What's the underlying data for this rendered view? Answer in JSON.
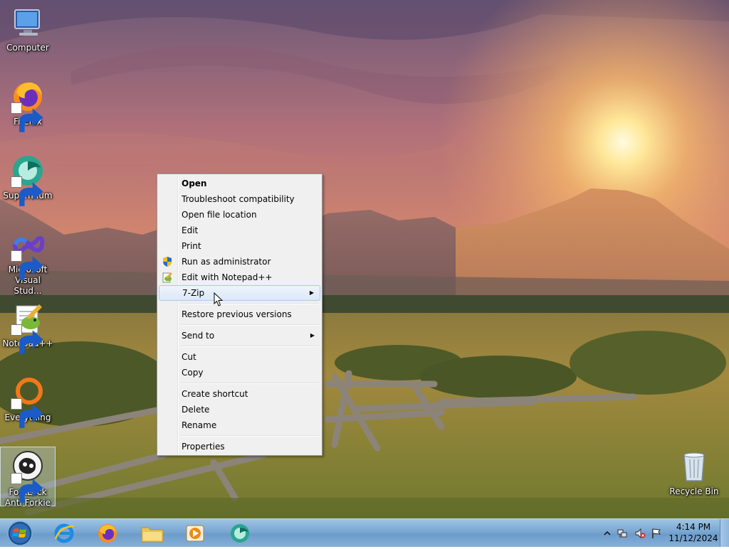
{
  "desktop": {
    "icons": [
      {
        "label": "Computer",
        "icon": "computer-icon"
      },
      {
        "label": "Firefox",
        "icon": "firefox-icon"
      },
      {
        "label": "Supermium",
        "icon": "supermium-icon"
      },
      {
        "label": "Microsoft Visual Stud...",
        "icon": "visual-studio-icon"
      },
      {
        "label": "Notepad++",
        "icon": "notepad-plus-plus-icon"
      },
      {
        "label": "Everything",
        "icon": "everything-icon"
      },
      {
        "label": "ForkLock Anti Forkie",
        "icon": "forklock-icon"
      },
      {
        "label": "Recycle Bin",
        "icon": "recycle-bin-icon"
      }
    ]
  },
  "context_menu": {
    "items": [
      {
        "label": "Open",
        "bold": true
      },
      {
        "label": "Troubleshoot compatibility"
      },
      {
        "label": "Open file location"
      },
      {
        "label": "Edit"
      },
      {
        "label": "Print"
      },
      {
        "label": "Run as administrator",
        "icon": "uac-shield-icon"
      },
      {
        "label": "Edit with Notepad++",
        "icon": "notepad-plus-plus-icon"
      },
      {
        "label": "7-Zip",
        "submenu": true,
        "hover": true
      },
      {
        "label": "Restore previous versions"
      },
      {
        "label": "Send to",
        "submenu": true
      },
      {
        "label": "Cut"
      },
      {
        "label": "Copy"
      },
      {
        "label": "Create shortcut"
      },
      {
        "label": "Delete"
      },
      {
        "label": "Rename"
      },
      {
        "label": "Properties"
      }
    ],
    "submenu_arrow": "▶"
  },
  "taskbar": {
    "pinned": [
      "internet-explorer-icon",
      "firefox-icon",
      "file-explorer-icon",
      "media-player-icon",
      "supermium-icon"
    ],
    "tray_icons": [
      "show-hidden-icons-chevron",
      "network-icon",
      "volume-muted-icon",
      "action-center-flag-icon"
    ],
    "clock": {
      "time": "4:14 PM",
      "date": "11/12/2024"
    }
  },
  "colors": {
    "menu_bg": "#f0f0f0",
    "menu_hover": "#dce9f7",
    "taskbar": "#7aa7d2"
  }
}
